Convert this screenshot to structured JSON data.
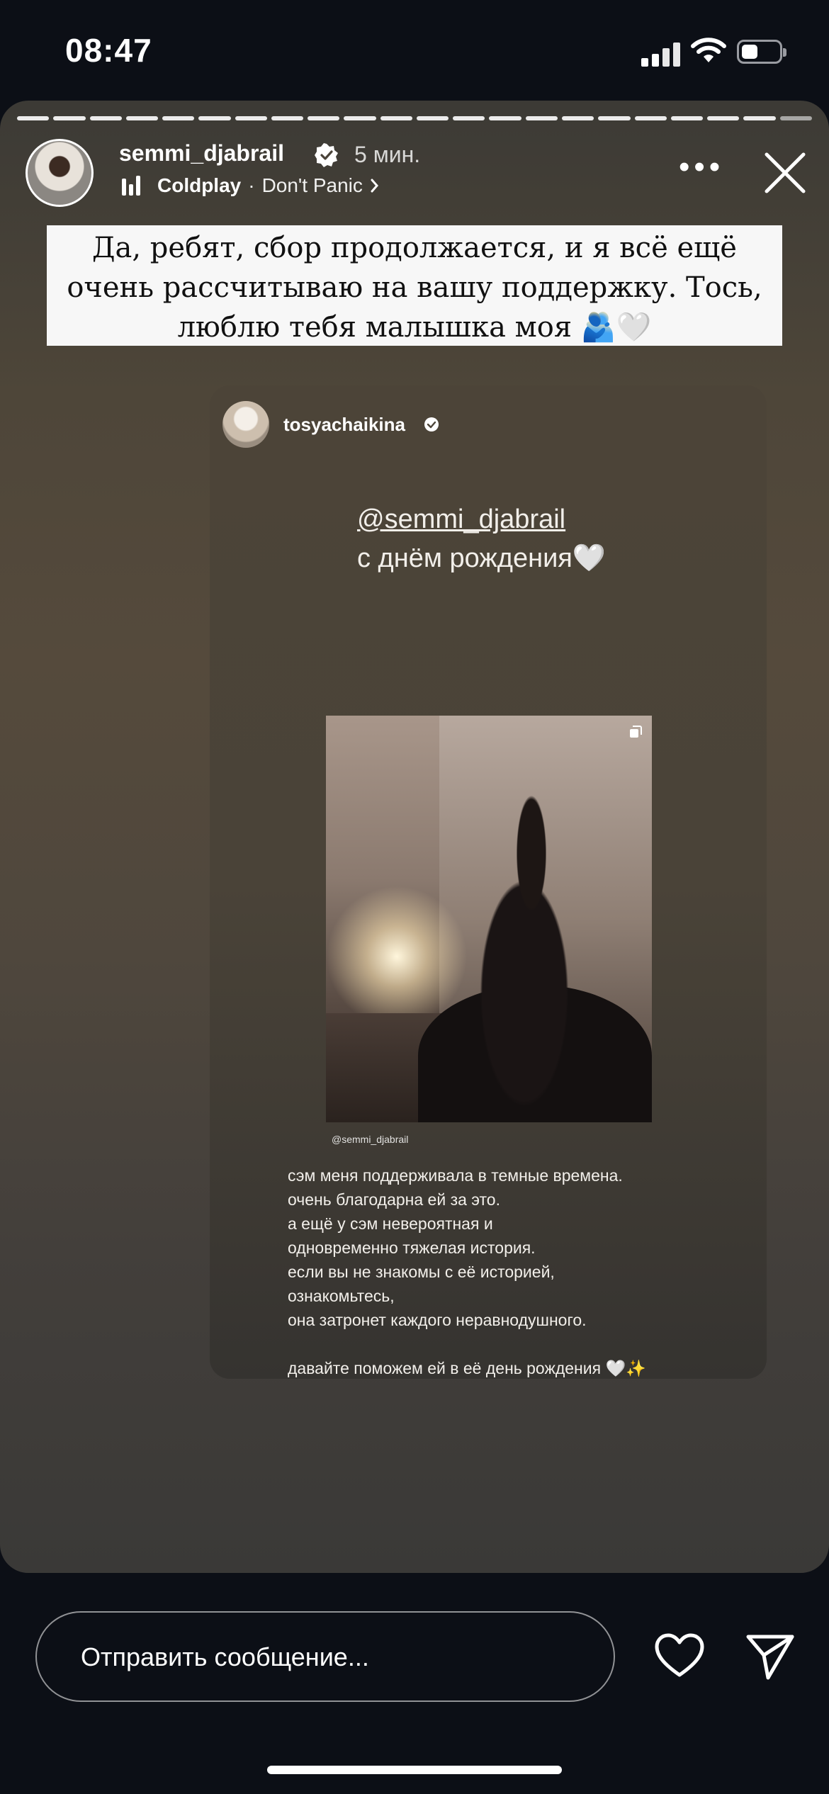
{
  "status_bar": {
    "time": "08:47"
  },
  "story": {
    "progress": {
      "total": 22,
      "current": 21
    },
    "username": "semmi_djabrail",
    "time_ago": "5 мин.",
    "music": {
      "artist": "Coldplay",
      "separator": "·",
      "song": "Don't Panic"
    },
    "caption": "Да, ребят, сбор продолжается, и я всё ещё очень рассчитываю на вашу поддержку. Тось, люблю тебя малышка моя 🫂🤍"
  },
  "repost": {
    "username": "tosyachaikina",
    "mention": "@semmi_djabrail",
    "birthday": "с днём рождения🤍",
    "photo_credit": "@semmi_djabrail",
    "body": "сэм меня поддерживала в темные времена.\nочень благодарна ей за это.\nа ещё у сэм невероятная и\nодновременно тяжелая история.\nесли вы не знакомы с её историей,\nознакомьтесь,\nона затронет каждого неравнодушного.",
    "footer": "давайте поможем ей в её день рождения 🤍✨"
  },
  "bottom_bar": {
    "reply_placeholder": "Отправить сообщение..."
  },
  "icons": {
    "signal": "signal-bars-icon",
    "wifi": "wifi-icon",
    "battery": "battery-icon",
    "verified": "verified-badge-icon",
    "music": "music-bars-icon",
    "more": "more-dots-icon",
    "close": "close-icon",
    "like": "heart-icon",
    "send": "send-icon"
  }
}
